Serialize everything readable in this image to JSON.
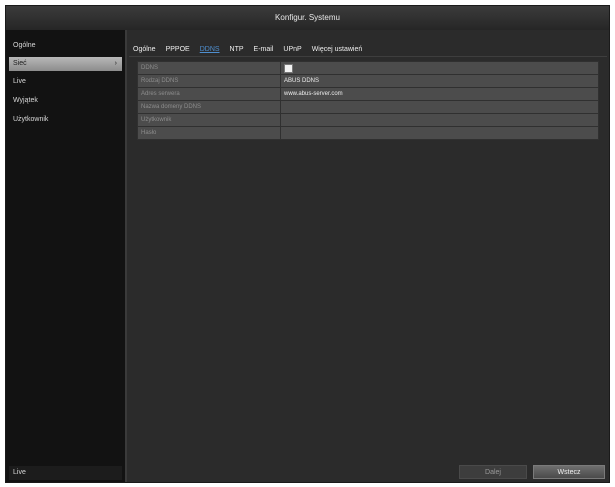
{
  "window": {
    "title": "Konfigur. Systemu"
  },
  "sidebar": {
    "items": [
      {
        "label": "Ogólne"
      },
      {
        "label": "Sieć",
        "chevron": "›"
      },
      {
        "label": "Live"
      },
      {
        "label": "Wyjątek"
      },
      {
        "label": "Użytkownik"
      }
    ],
    "footer": "Live"
  },
  "tabs": [
    {
      "label": "Ogólne"
    },
    {
      "label": "PPPOE"
    },
    {
      "label": "DDNS"
    },
    {
      "label": "NTP"
    },
    {
      "label": "E-mail"
    },
    {
      "label": "UPnP"
    },
    {
      "label": "Więcej ustawień"
    }
  ],
  "form": {
    "rows": [
      {
        "label": "DDNS",
        "value": "",
        "checkbox": true
      },
      {
        "label": "Rodzaj DDNS",
        "value": "ABUS DDNS"
      },
      {
        "label": "Adres serwera",
        "value": "www.abus-server.com"
      },
      {
        "label": "Nazwa domeny DDNS",
        "value": ""
      },
      {
        "label": "Użytkownik",
        "value": ""
      },
      {
        "label": "Hasło",
        "value": ""
      }
    ]
  },
  "buttons": {
    "apply": "Dalej",
    "exit": "Wstecz"
  }
}
